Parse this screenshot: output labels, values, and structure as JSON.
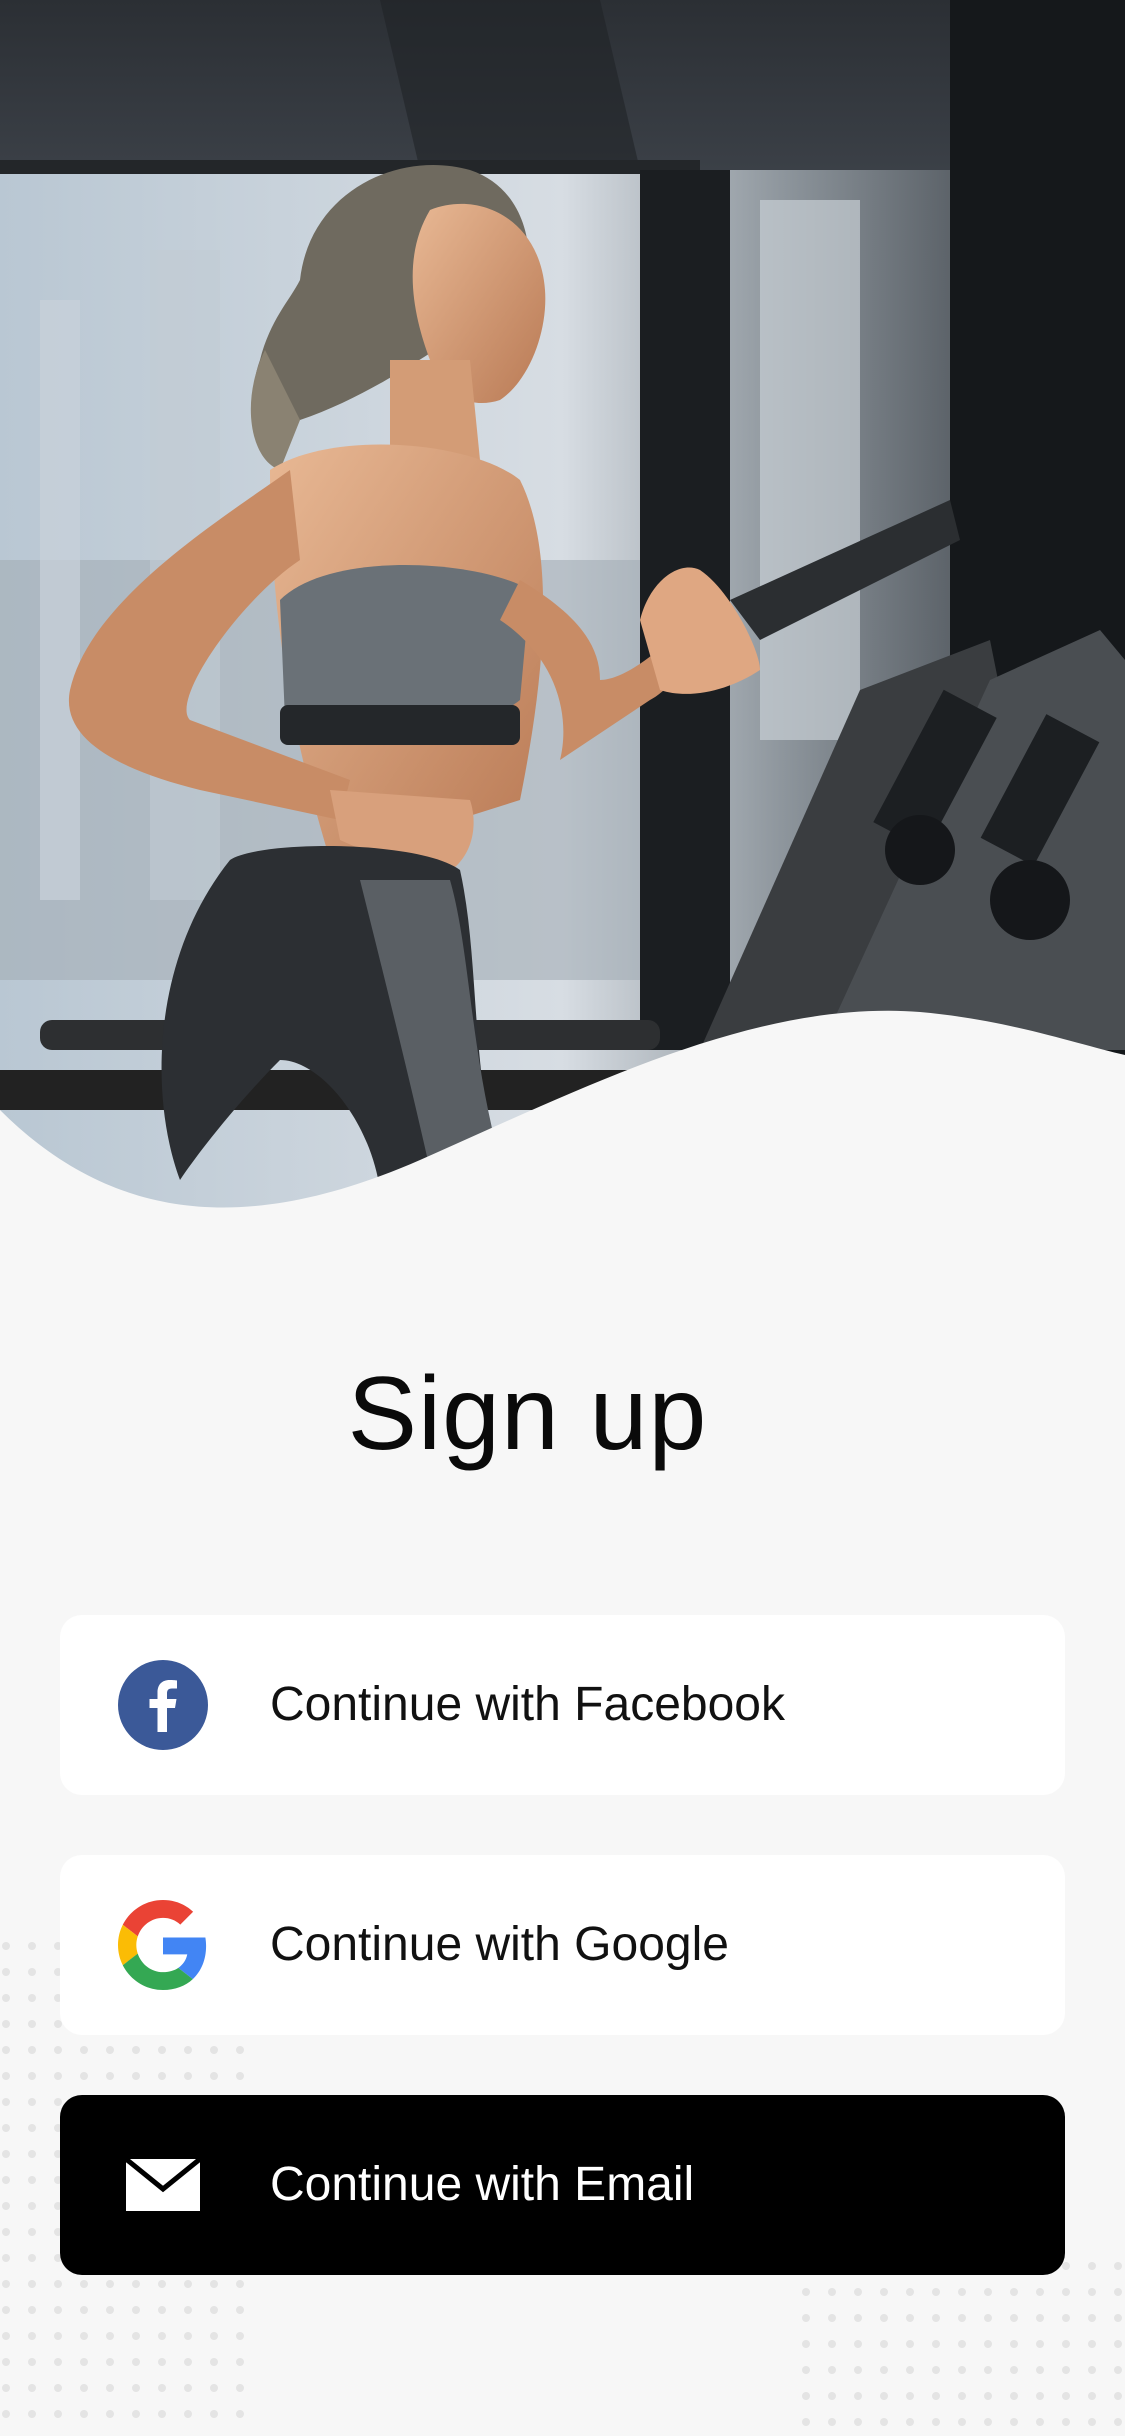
{
  "hero": {
    "image": "woman running on treadmill in gym"
  },
  "title": "Sign up",
  "buttons": {
    "facebook": {
      "label": "Continue with Facebook",
      "icon": "facebook-icon"
    },
    "google": {
      "label": "Continue with Google",
      "icon": "google-icon"
    },
    "email": {
      "label": "Continue with Email",
      "icon": "envelope-icon"
    }
  },
  "colors": {
    "background": "#f7f7f7",
    "facebook_blue": "#3b5998",
    "email_button": "#000000",
    "button_white": "#ffffff"
  }
}
